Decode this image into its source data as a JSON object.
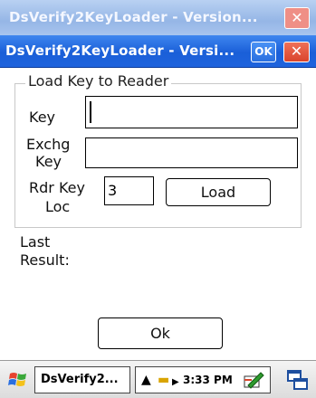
{
  "background_window": {
    "title": "DsVerify2KeyLoader - Version...",
    "close_label": "✕"
  },
  "window": {
    "title": "DsVerify2KeyLoader - Versi...",
    "ok_label": "OK",
    "close_label": "✕"
  },
  "group": {
    "label": "Load Key to Reader",
    "key_label": "Key",
    "key_value": "",
    "exchg_key_label_1": "Exchg",
    "exchg_key_label_2": "Key",
    "exchg_key_value": "",
    "rdr_key_loc_label_1": "Rdr Key",
    "rdr_key_loc_label_2": "Loc",
    "rdr_key_loc_value": "3",
    "load_button": "Load"
  },
  "result": {
    "label_1": "Last",
    "label_2": "Result:"
  },
  "ok_button": "Ok",
  "taskbar": {
    "task_label": "DsVerify2...",
    "clock": "3:33 PM"
  },
  "colors": {
    "title_active": "#1a5fd8",
    "title_inactive": "#95b6e6",
    "close": "#d9452c"
  }
}
